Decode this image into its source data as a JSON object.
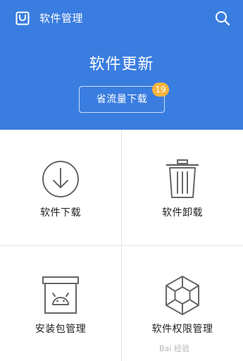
{
  "header": {
    "title": "软件管理",
    "logo_icon": "shopping-bag-icon",
    "search_icon": "search-icon"
  },
  "hero": {
    "title": "软件更新",
    "button_label": "省流量下载",
    "badge_count": "19"
  },
  "grid": {
    "items": [
      {
        "label": "软件下载",
        "icon": "download-circle-icon"
      },
      {
        "label": "软件卸载",
        "icon": "trash-can-icon"
      },
      {
        "label": "安装包管理",
        "icon": "android-box-icon"
      },
      {
        "label": "软件权限管理",
        "icon": "hexagon-shield-icon"
      }
    ]
  },
  "watermark": "Bai 经验",
  "colors": {
    "primary": "#3a7de0",
    "badge": "#f5b43c",
    "icon_gray": "#666666",
    "divider": "#e6e6e6"
  }
}
